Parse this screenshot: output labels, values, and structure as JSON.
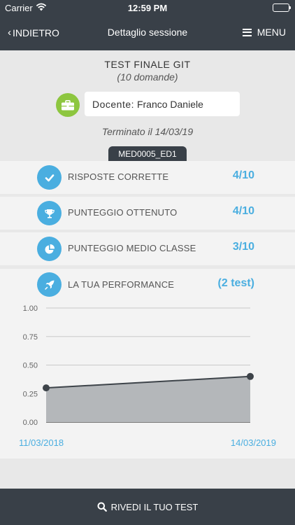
{
  "status_bar": {
    "carrier": "Carrier",
    "time": "12:59 PM"
  },
  "nav": {
    "back_label": "INDIETRO",
    "title": "Dettaglio sessione",
    "menu_label": "MENU"
  },
  "session": {
    "title": "TEST FINALE GIT",
    "subtitle": "(10 domande)",
    "teacher_label": "Docente:",
    "teacher_name": "Franco Daniele",
    "ended": "Terminato il 14/03/19",
    "code": "MED0005_ED1"
  },
  "stats": [
    {
      "icon": "check-icon",
      "label": "RISPOSTE CORRETTE",
      "value": "4/10"
    },
    {
      "icon": "trophy-icon",
      "label": "PUNTEGGIO OTTENUTO",
      "value": "4/10"
    },
    {
      "icon": "pie-chart-icon",
      "label": "PUNTEGGIO MEDIO CLASSE",
      "value": "3/10"
    }
  ],
  "performance": {
    "icon": "rocket-icon",
    "label": "LA TUA PERFORMANCE",
    "value": "(2 test)"
  },
  "chart_data": {
    "type": "area",
    "x": [
      "11/03/2018",
      "14/03/2019"
    ],
    "values": [
      0.3,
      0.4
    ],
    "ylim": [
      0,
      1
    ],
    "yticks": [
      "1.00",
      "0.75",
      "0.50",
      "0.25",
      "0.00"
    ],
    "grid": true
  },
  "bottom": {
    "review_label": "RIVEDI IL TUO TEST"
  },
  "colors": {
    "accent": "#4aaee0",
    "dark": "#394048",
    "teacher_icon": "#8dc63f",
    "area_fill": "#b4b7ba"
  }
}
